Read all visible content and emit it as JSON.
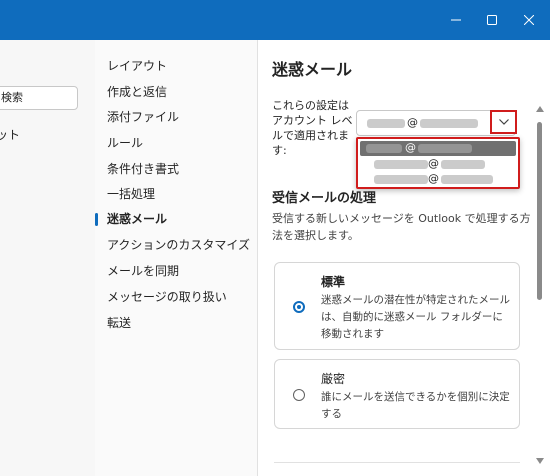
{
  "left_pane": {
    "search_fragment": "検索",
    "label_fragment": "ット"
  },
  "nav": {
    "items": [
      {
        "label": "レイアウト"
      },
      {
        "label": "作成と返信"
      },
      {
        "label": "添付ファイル"
      },
      {
        "label": "ルール"
      },
      {
        "label": "条件付き書式"
      },
      {
        "label": "一括処理"
      },
      {
        "label": "迷惑メール"
      },
      {
        "label": "アクションのカスタマイズ"
      },
      {
        "label": "メールを同期"
      },
      {
        "label": "メッセージの取り扱い"
      },
      {
        "label": "転送"
      }
    ],
    "active_index": 6
  },
  "settings": {
    "title": "迷惑メール",
    "account_label": "これらの設定はアカウント レベルで適用されます:",
    "account_at": "@",
    "dropdown_options": [
      {
        "at": "@",
        "selected": true
      },
      {
        "at": "@",
        "selected": false
      },
      {
        "at": "@",
        "selected": false
      }
    ],
    "section_title": "受信メールの処理",
    "section_desc": "受信する新しいメッセージを Outlook で処理する方法を選択します。",
    "options": [
      {
        "title": "標準",
        "desc": "迷惑メールの潜在性が特定されたメールは、自動的に迷惑メール フォルダーに移動されます",
        "checked": true
      },
      {
        "title": "厳密",
        "desc": "誰にメールを送信できるかを個別に決定する",
        "checked": false
      }
    ]
  },
  "colors": {
    "titlebar": "#0f6cbd",
    "accent": "#0f6cbd",
    "highlight_border": "#d01c1c"
  },
  "icons": {
    "minimize": "minimize-icon",
    "maximize": "maximize-icon",
    "close": "close-icon",
    "dropdown": "chevron-down-icon"
  }
}
